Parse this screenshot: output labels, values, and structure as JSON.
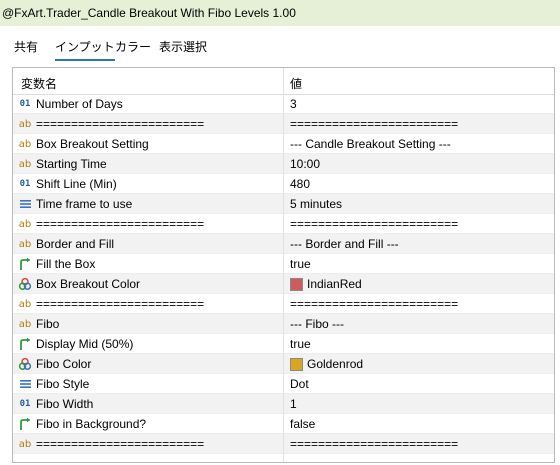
{
  "window": {
    "title": "@FxArt.Trader_Candle Breakout With Fibo Levels 1.00"
  },
  "tabs": [
    {
      "label": "共有"
    },
    {
      "label": "インプット"
    },
    {
      "label": "カラー"
    },
    {
      "label": "表示選択"
    }
  ],
  "active_tab": 1,
  "grid": {
    "col_name": "変数名",
    "col_value": "値",
    "rows": [
      {
        "icon": "int-icon",
        "name": "Number of Days",
        "value": "3"
      },
      {
        "icon": "string-icon",
        "name": "========================",
        "value": "========================"
      },
      {
        "icon": "string-icon",
        "name": "Box Breakout Setting",
        "value": "--- Candle Breakout Setting ---"
      },
      {
        "icon": "string-icon",
        "name": "Starting Time",
        "value": "10:00"
      },
      {
        "icon": "int-icon",
        "name": "Shift Line (Min)",
        "value": "480"
      },
      {
        "icon": "enum-icon",
        "name": "Time frame to use",
        "value": "5 minutes"
      },
      {
        "icon": "string-icon",
        "name": "========================",
        "value": "========================"
      },
      {
        "icon": "string-icon",
        "name": "Border and Fill",
        "value": "--- Border and Fill ---"
      },
      {
        "icon": "bool-icon",
        "name": "Fill the Box",
        "value": "true"
      },
      {
        "icon": "color-icon",
        "name": "Box Breakout Color",
        "value": "IndianRed",
        "swatch": "#cd5c5c"
      },
      {
        "icon": "string-icon",
        "name": "========================",
        "value": "========================"
      },
      {
        "icon": "string-icon",
        "name": "Fibo",
        "value": "--- Fibo ---"
      },
      {
        "icon": "bool-icon",
        "name": "Display Mid (50%)",
        "value": "true"
      },
      {
        "icon": "color-icon",
        "name": "Fibo Color",
        "value": "Goldenrod",
        "swatch": "#daa520"
      },
      {
        "icon": "enum-icon",
        "name": "Fibo Style",
        "value": "Dot"
      },
      {
        "icon": "int-icon",
        "name": "Fibo Width",
        "value": "1"
      },
      {
        "icon": "bool-icon",
        "name": "Fibo in Background?",
        "value": "false"
      },
      {
        "icon": "string-icon",
        "name": "========================",
        "value": "========================"
      }
    ]
  },
  "colors": {
    "title_bg": "#e6f0d7",
    "tab_underline": "#2a6fc9"
  }
}
